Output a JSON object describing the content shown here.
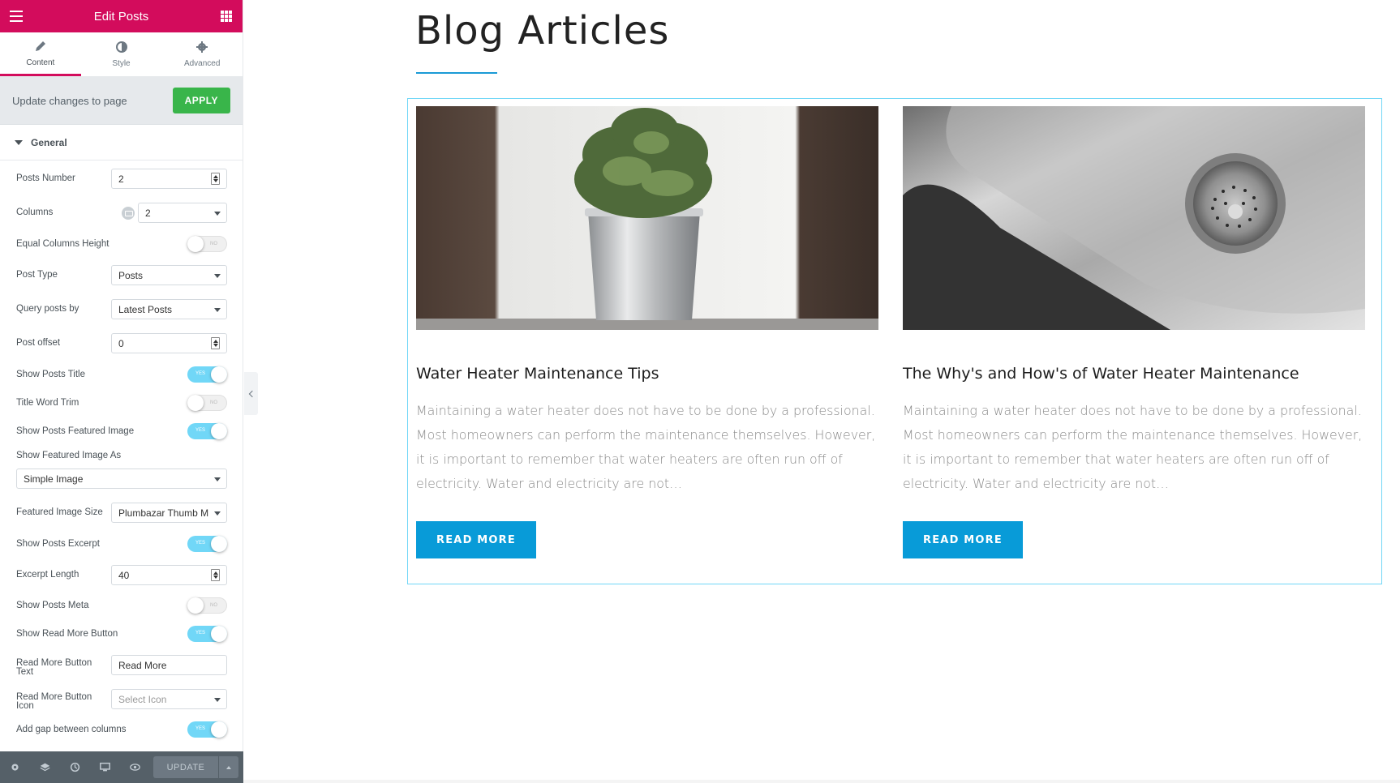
{
  "panel": {
    "title": "Edit Posts",
    "tabs": [
      {
        "label": "Content",
        "icon": "pencil-icon"
      },
      {
        "label": "Style",
        "icon": "half-circle-icon"
      },
      {
        "label": "Advanced",
        "icon": "gear-icon"
      }
    ],
    "update_bar": {
      "message": "Update changes to page",
      "apply_label": "APPLY"
    },
    "section": "General",
    "controls": {
      "posts_number": {
        "label": "Posts Number",
        "value": "2"
      },
      "columns": {
        "label": "Columns",
        "value": "2"
      },
      "equal_columns_height": {
        "label": "Equal Columns Height",
        "state": "NO"
      },
      "post_type": {
        "label": "Post Type",
        "value": "Posts"
      },
      "query_posts_by": {
        "label": "Query posts by",
        "value": "Latest Posts"
      },
      "post_offset": {
        "label": "Post offset",
        "value": "0"
      },
      "show_posts_title": {
        "label": "Show Posts Title",
        "state": "YES"
      },
      "title_word_trim": {
        "label": "Title Word Trim",
        "state": "NO"
      },
      "show_featured_image": {
        "label": "Show Posts Featured Image",
        "state": "YES"
      },
      "featured_image_as": {
        "label": "Show Featured Image As",
        "value": "Simple Image"
      },
      "featured_image_size": {
        "label": "Featured Image Size",
        "value": "Plumbazar Thumb M"
      },
      "show_posts_excerpt": {
        "label": "Show Posts Excerpt",
        "state": "YES"
      },
      "excerpt_length": {
        "label": "Excerpt Length",
        "value": "40"
      },
      "show_posts_meta": {
        "label": "Show Posts Meta",
        "state": "NO"
      },
      "show_read_more": {
        "label": "Show Read More Button",
        "state": "YES"
      },
      "read_more_text": {
        "label_line1": "Read More Button",
        "label_line2": "Text",
        "value": "Read More"
      },
      "read_more_icon": {
        "label_line1": "Read More Button",
        "label_line2": "Icon",
        "placeholder": "Select Icon"
      },
      "gap_between_columns": {
        "label": "Add gap between columns",
        "state": "YES"
      }
    },
    "footer": {
      "icons": [
        "settings-icon",
        "layers-icon",
        "history-icon",
        "responsive-icon",
        "preview-icon"
      ],
      "update_label": "UPDATE"
    }
  },
  "preview": {
    "heading": "Blog Articles",
    "posts": [
      {
        "title": "Water Heater Maintenance Tips",
        "excerpt": "Maintaining a water heater does not have to be done by a professional. Most homeowners can perform the maintenance themselves. However, it is important to remember that water heaters are often run off of electricity. Water and electricity are not…",
        "button": "READ MORE",
        "image": "potted-plant-image"
      },
      {
        "title": "The Why's and How's of Water Heater Maintenance",
        "excerpt": "Maintaining a water heater does not have to be done by a professional. Most homeowners can perform the maintenance themselves. However, it is important to remember that water heaters are often run off of electricity. Water and electricity are not…",
        "button": "READ MORE",
        "image": "steel-sink-image"
      }
    ]
  },
  "colors": {
    "brand": "#d30c5c",
    "apply": "#39b54a",
    "toggle_on": "#71d7f7",
    "button": "#089bd8",
    "accent_line": "#1a9ad6"
  }
}
